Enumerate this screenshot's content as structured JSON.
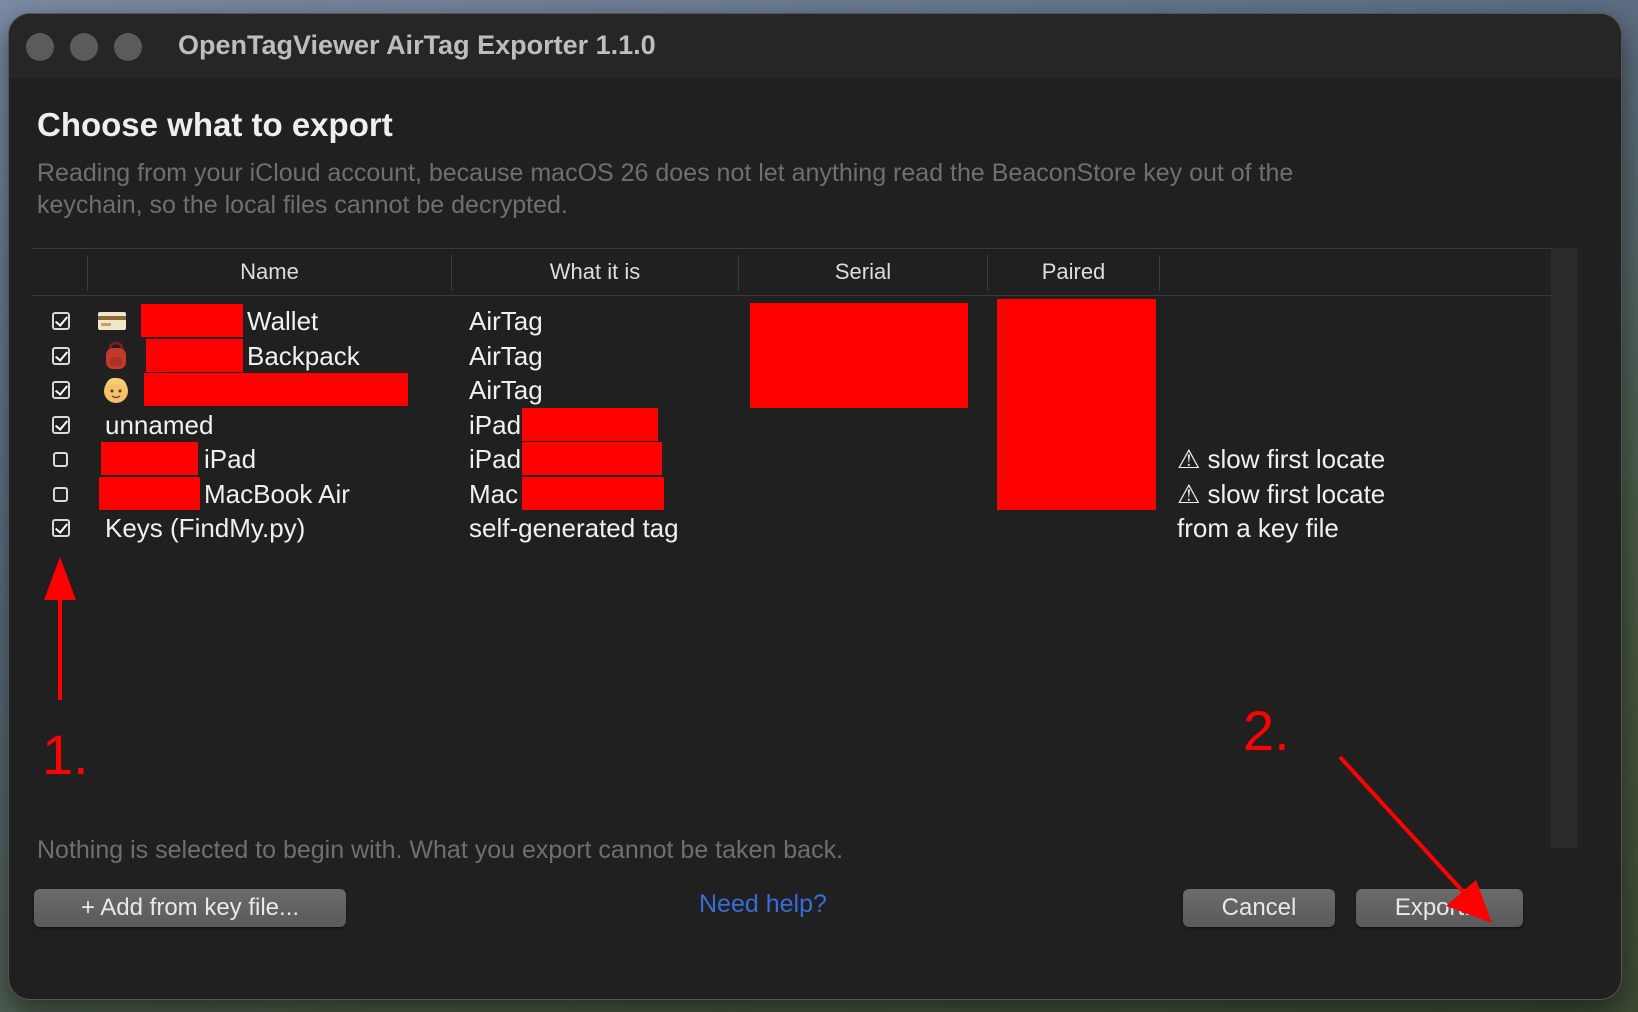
{
  "window": {
    "title": "OpenTagViewer AirTag Exporter 1.1.0"
  },
  "dialog": {
    "heading": "Choose what to export",
    "subtitle": "Reading from your iCloud account, because macOS 26 does not let anything read the BeaconStore key out of the keychain, so the local files cannot be decrypted.",
    "footnote": "Nothing is selected to begin with. What you export cannot be taken back."
  },
  "table": {
    "columns": [
      "Name",
      "What it is",
      "Serial",
      "Paired"
    ],
    "rows": [
      {
        "checked": true,
        "icon": "credit-card-icon",
        "name": "Wallet",
        "kind": "AirTag",
        "note": ""
      },
      {
        "checked": true,
        "icon": "backpack-icon",
        "name": "Backpack",
        "kind": "AirTag",
        "note": ""
      },
      {
        "checked": true,
        "icon": "face-icon",
        "name": "",
        "kind": "AirTag",
        "note": ""
      },
      {
        "checked": true,
        "icon": "",
        "name": "unnamed",
        "kind": "iPad",
        "note": ""
      },
      {
        "checked": false,
        "icon": "",
        "name": "iPad",
        "kind": "iPad",
        "note": "⚠ slow first locate"
      },
      {
        "checked": false,
        "icon": "",
        "name": "MacBook Air",
        "kind": "Mac",
        "note": "⚠ slow first locate"
      },
      {
        "checked": true,
        "icon": "",
        "name": "Keys (FindMy.py)",
        "kind": "self-generated tag",
        "note": "from a key file"
      }
    ]
  },
  "buttons": {
    "add": "+ Add from key file...",
    "help": "Need help?",
    "cancel": "Cancel",
    "export": "Export..."
  },
  "annotations": {
    "step1": "1.",
    "step2": "2.",
    "color": "#ff0000"
  },
  "colors": {
    "redaction": "#ff0000",
    "link": "#3a6bd9"
  }
}
